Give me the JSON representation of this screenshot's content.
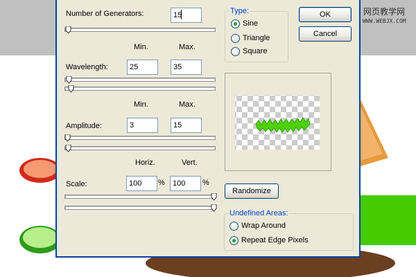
{
  "dialog": {
    "generators": {
      "label": "Number of Generators:",
      "value": "15"
    },
    "minmax_headers": {
      "min": "Min.",
      "max": "Max."
    },
    "wavelength": {
      "label": "Wavelength:",
      "min": "25",
      "max": "35"
    },
    "amplitude": {
      "label": "Amplitude:",
      "min": "3",
      "max": "15"
    },
    "scale_headers": {
      "horiz": "Horiz.",
      "vert": "Vert."
    },
    "scale": {
      "label": "Scale:",
      "horiz": "100",
      "vert": "100",
      "unit": "%"
    },
    "type": {
      "title": "Type:",
      "options": [
        "Sine",
        "Triangle",
        "Square"
      ],
      "selected": "Sine"
    },
    "buttons": {
      "ok": "OK",
      "cancel": "Cancel",
      "randomize": "Randomize"
    },
    "undefined_areas": {
      "title": "Undefined Areas:",
      "options": [
        "Wrap Around",
        "Repeat Edge Pixels"
      ],
      "selected": "Repeat Edge Pixels"
    }
  },
  "watermark": {
    "line1": "网页教学网",
    "line2": "WWW.WEBJX.COM"
  },
  "colors": {
    "dialog_bg": "#ece9d8",
    "border": "#0b3fa8",
    "preview_green": "#3dbf1a",
    "wave_green": "#4fd10a"
  }
}
